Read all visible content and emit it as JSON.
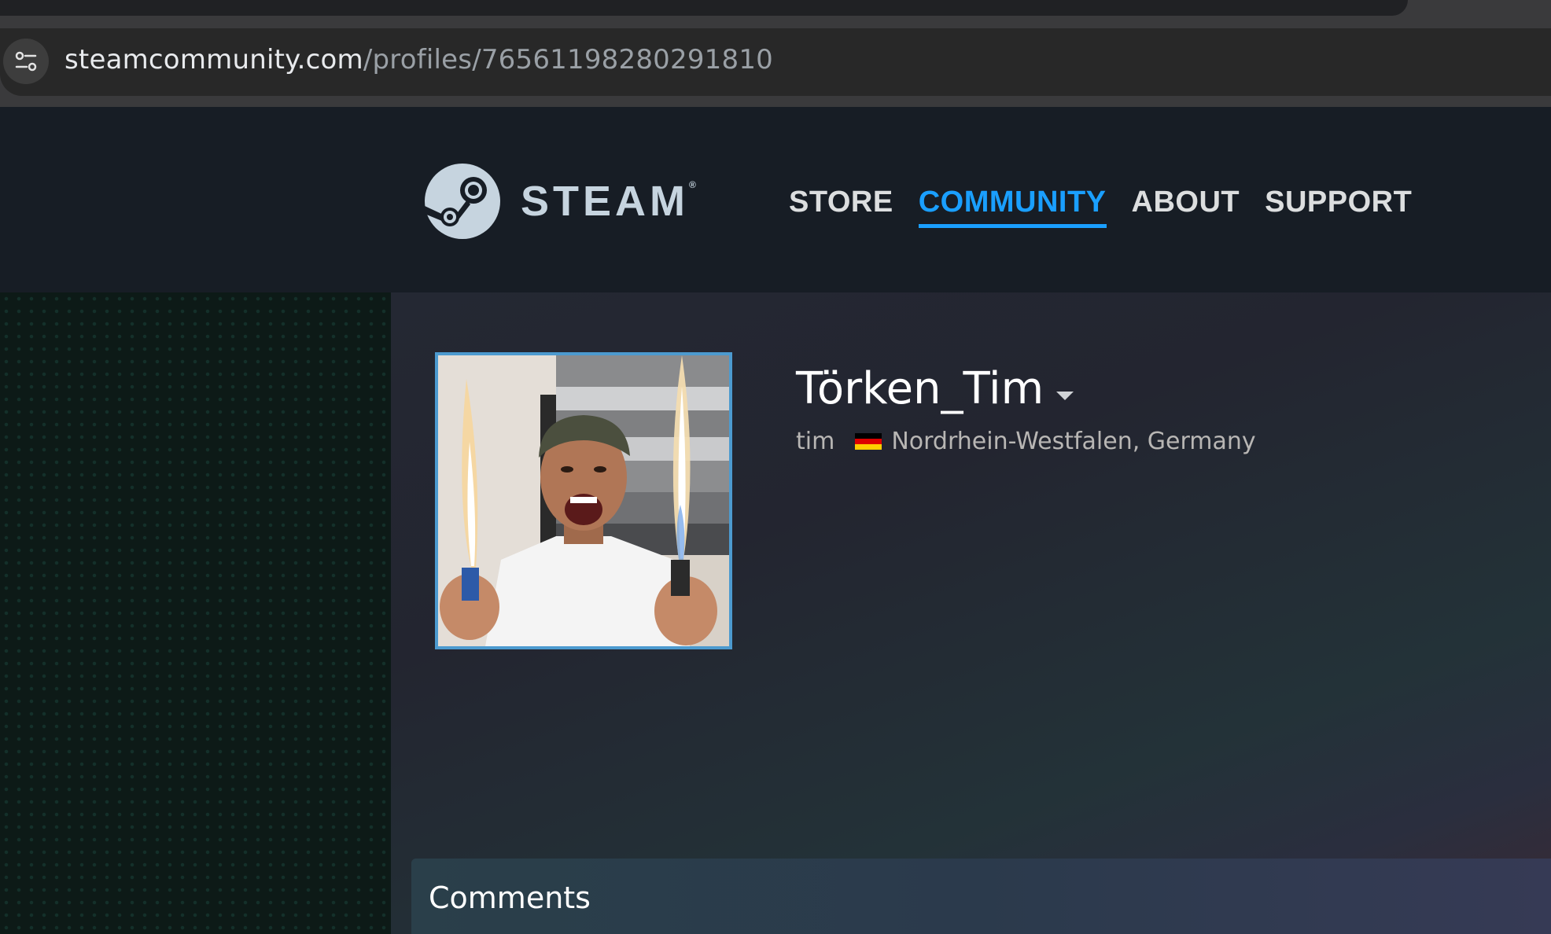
{
  "browser": {
    "url_host": "steamcommunity.com",
    "url_path": "/profiles/76561198280291810"
  },
  "header": {
    "logo_text": "STEAM",
    "logo_reg": "®",
    "nav": [
      {
        "label": "STORE",
        "active": false
      },
      {
        "label": "COMMUNITY",
        "active": true
      },
      {
        "label": "ABOUT",
        "active": false
      },
      {
        "label": "SUPPORT",
        "active": false
      }
    ]
  },
  "profile": {
    "persona_name": "Törken_Tim",
    "real_name": "tim",
    "location": "Nordrhein-Westfalen, Germany",
    "flag_colors": [
      "#000000",
      "#dd0000",
      "#ffce00"
    ]
  },
  "comments": {
    "title": "Comments"
  },
  "colors": {
    "accent": "#1a9fff",
    "avatar_border": "#4c9acf"
  }
}
